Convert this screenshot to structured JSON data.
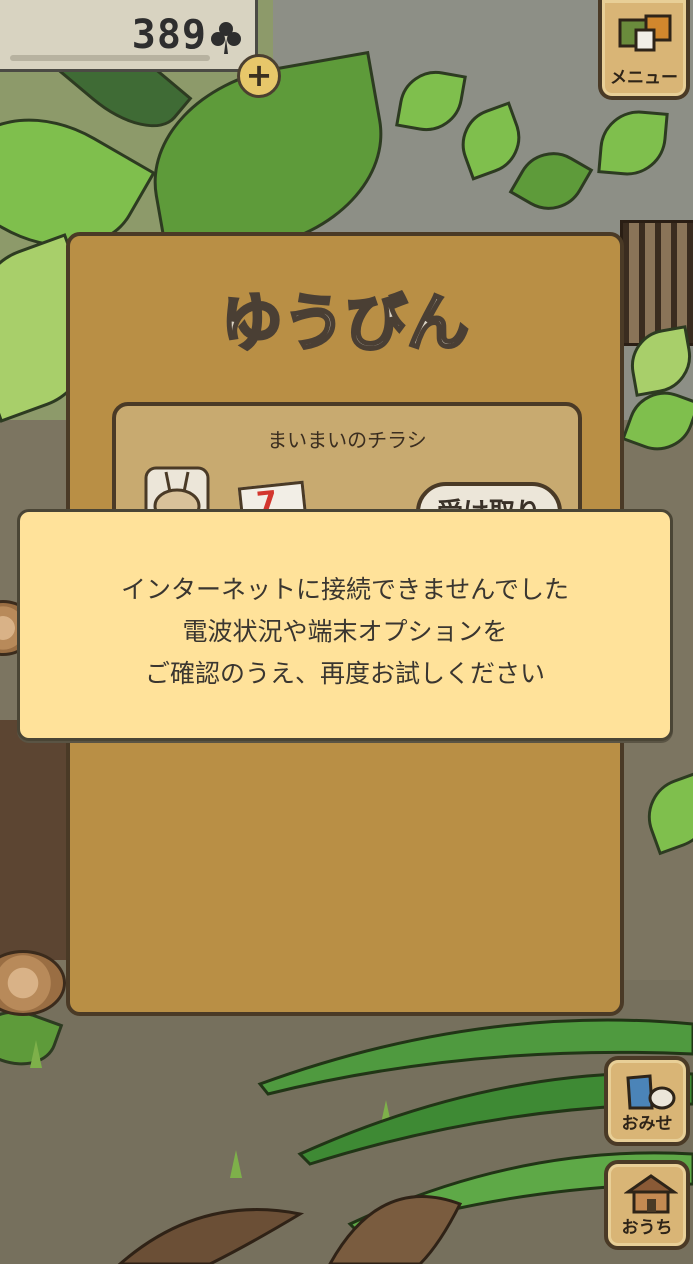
{
  "hud": {
    "clover_count": "389",
    "plus_label": "+",
    "menu_label": "メニュー"
  },
  "mail_panel": {
    "title": "ゆうびん",
    "card": {
      "title": "まいまいのチラシ",
      "receive_button": "受け取り",
      "flyer_mark": "7"
    }
  },
  "dialog": {
    "lines": [
      "インターネットに接続できませんでした",
      "電波状況や端末オプションを",
      "ご確認のうえ、再度お試しください"
    ]
  },
  "side_buttons": {
    "shop_label": "おみせ",
    "home_label": "おうち"
  },
  "colors": {
    "panel": "#b98f45",
    "dialog": "#ffe29a",
    "button": "#d9b576"
  }
}
